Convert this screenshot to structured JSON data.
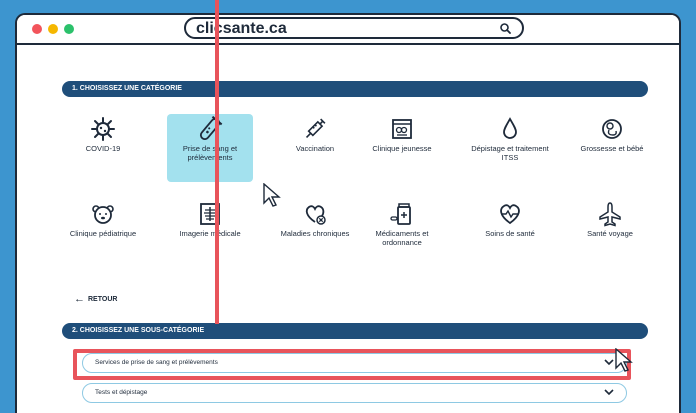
{
  "browser": {
    "url": "clicsante.ca",
    "search_icon": "search-icon"
  },
  "section1": {
    "title": "1. CHOISISSEZ UNE CATÉGORIE",
    "categories": [
      {
        "label": "COVID-19",
        "icon": "virus-icon",
        "selected": false
      },
      {
        "label": "Prise de sang et prélèvements",
        "icon": "test-tube-icon",
        "selected": true
      },
      {
        "label": "Vaccination",
        "icon": "syringe-icon",
        "selected": false
      },
      {
        "label": "Clinique jeunesse",
        "icon": "youth-clinic-icon",
        "selected": false
      },
      {
        "label": "Dépistage et traitement ITSS",
        "icon": "drop-icon",
        "selected": false
      },
      {
        "label": "Grossesse et bébé",
        "icon": "fetus-icon",
        "selected": false
      },
      {
        "label": "Clinique pédiatrique",
        "icon": "teddy-bear-icon",
        "selected": false
      },
      {
        "label": "Imagerie médicale",
        "icon": "xray-icon",
        "selected": false
      },
      {
        "label": "Maladies chroniques",
        "icon": "heart-x-icon",
        "selected": false
      },
      {
        "label": "Médicaments et ordonnance",
        "icon": "pill-bottle-icon",
        "selected": false
      },
      {
        "label": "Soins de santé",
        "icon": "heartbeat-icon",
        "selected": false
      },
      {
        "label": "Santé voyage",
        "icon": "airplane-icon",
        "selected": false
      }
    ]
  },
  "back_label": "RETOUR",
  "section2": {
    "title": "2. CHOISISSEZ UNE SOUS-CATÉGORIE",
    "options": [
      {
        "label": "Services de prise de sang et prélèvements"
      },
      {
        "label": "Tests et dépistage"
      }
    ]
  },
  "colors": {
    "background": "#3d95cf",
    "section_bar": "#1f4e7a",
    "selected_tile": "#a3e1ee",
    "highlight": "#e8545b",
    "dropdown_border": "#8ec9e3"
  }
}
